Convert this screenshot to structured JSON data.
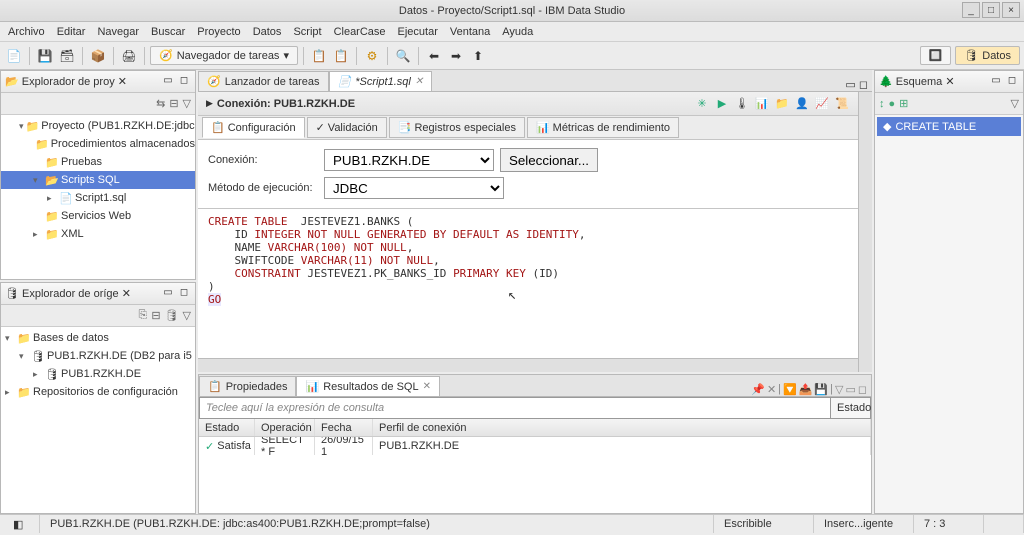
{
  "window": {
    "title": "Datos - Proyecto/Script1.sql - IBM Data Studio"
  },
  "menu": [
    "Archivo",
    "Editar",
    "Navegar",
    "Buscar",
    "Proyecto",
    "Datos",
    "Script",
    "ClearCase",
    "Ejecutar",
    "Ventana",
    "Ayuda"
  ],
  "toolbar": {
    "taskNav": "Navegador de tareas",
    "datosBtn": "Datos"
  },
  "leftTop": {
    "title": "Explorador de proy",
    "items": [
      {
        "label": "Proyecto (PUB1.RZKH.DE:jdbc:",
        "depth": 1,
        "twisty": "▾",
        "icon": "📁"
      },
      {
        "label": "Procedimientos almacenados",
        "depth": 2,
        "twisty": "",
        "icon": "📁"
      },
      {
        "label": "Pruebas",
        "depth": 2,
        "twisty": "",
        "icon": "📁"
      },
      {
        "label": "Scripts SQL",
        "depth": 2,
        "twisty": "▾",
        "icon": "📂",
        "sel": true
      },
      {
        "label": "Script1.sql",
        "depth": 3,
        "twisty": "▸",
        "icon": "📄"
      },
      {
        "label": "Servicios Web",
        "depth": 2,
        "twisty": "",
        "icon": "📁"
      },
      {
        "label": "XML",
        "depth": 2,
        "twisty": "▸",
        "icon": "📁"
      }
    ]
  },
  "leftMid": {
    "title": "Explorador de oríge",
    "items": [
      {
        "label": "Bases de datos",
        "depth": 0,
        "twisty": "▾",
        "icon": "📁"
      },
      {
        "label": "PUB1.RZKH.DE (DB2 para i5",
        "depth": 1,
        "twisty": "▾",
        "icon": "🛢"
      },
      {
        "label": "PUB1.RZKH.DE",
        "depth": 2,
        "twisty": "▸",
        "icon": "🛢"
      },
      {
        "label": "Repositorios de configuración",
        "depth": 0,
        "twisty": "▸",
        "icon": "📁"
      }
    ]
  },
  "editor": {
    "tab1": "Lanzador de tareas",
    "tab2": "*Script1.sql",
    "connLabel": "Conexión: ",
    "connValue": "PUB1.RZKH.DE",
    "subtabs": {
      "config": "Configuración",
      "valid": "Validación",
      "regs": "Registros especiales",
      "metrics": "Métricas de rendimiento"
    },
    "form": {
      "connLabel": "Conexión:",
      "connValue": "PUB1.RZKH.DE",
      "selectBtn": "Seleccionar...",
      "methodLabel": "Método de ejecución:",
      "methodValue": "JDBC"
    },
    "sql": {
      "l1a": "CREATE TABLE",
      "l1b": "  JESTEVEZ1.BANKS (",
      "l2a": "    ID ",
      "l2b": "INTEGER NOT NULL GENERATED BY DEFAULT AS IDENTITY",
      "l2c": ",",
      "l3a": "    NAME ",
      "l3b": "VARCHAR(100) NOT NULL",
      "l3c": ",",
      "l4a": "    SWIFTCODE ",
      "l4b": "VARCHAR(11) NOT NULL",
      "l4c": ",",
      "l5a": "    ",
      "l5b": "CONSTRAINT",
      "l5c": " JESTEVEZ1.PK_BANKS_ID ",
      "l5d": "PRIMARY KEY",
      "l5e": " (ID)",
      "l6": ")",
      "l7": "GO"
    }
  },
  "bottom": {
    "tab1": "Propiedades",
    "tab2": "Resultados de SQL",
    "queryPlaceholder": "Teclee aquí la expresión de consulta",
    "stateTab": "Estado",
    "cols": {
      "estado": "Estado",
      "op": "Operación",
      "fecha": "Fecha",
      "perfil": "Perfil de conexión"
    },
    "row": {
      "estado": "Satisfa",
      "op": "SELECT * F",
      "fecha": "26/09/15 1",
      "perfil": "PUB1.RZKH.DE"
    }
  },
  "right": {
    "title": "Esquema",
    "item": "CREATE TABLE"
  },
  "status": {
    "conn": "PUB1.RZKH.DE (PUB1.RZKH.DE: jdbc:as400:PUB1.RZKH.DE;prompt=false)",
    "writable": "Escribible",
    "insert": "Inserc...igente",
    "pos": "7 : 3"
  }
}
